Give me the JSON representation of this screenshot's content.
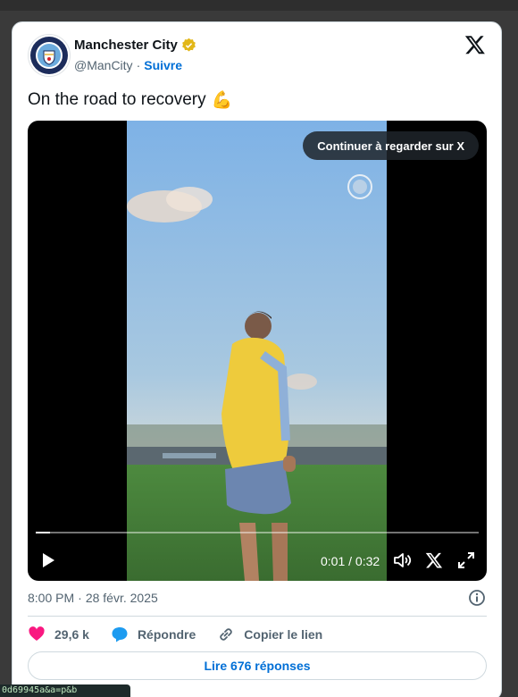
{
  "account": {
    "name": "Manchester City",
    "handle": "@ManCity",
    "separator": "·",
    "follow_label": "Suivre"
  },
  "tweet": {
    "text": "On the road to recovery",
    "emoji": "💪"
  },
  "video": {
    "continue_label": "Continuer à regarder sur X",
    "current_time": "0:01",
    "duration": "0:32",
    "time_display": "0:01 / 0:32",
    "progress_fraction": 0.03125
  },
  "meta": {
    "time": "8:00 PM",
    "separator": "·",
    "date": "28 févr. 2025"
  },
  "actions": {
    "likes": "29,6 k",
    "reply_label": "Répondre",
    "copy_link_label": "Copier le lien"
  },
  "read_replies_label": "Lire 676 réponses",
  "status_url_fragment": "0d69945a&a=p&b",
  "colors": {
    "link_blue": "#006fd6",
    "like_pink": "#f91880",
    "reply_blue": "#1d9bf0",
    "text_primary": "#0f1419",
    "text_secondary": "#536471"
  }
}
